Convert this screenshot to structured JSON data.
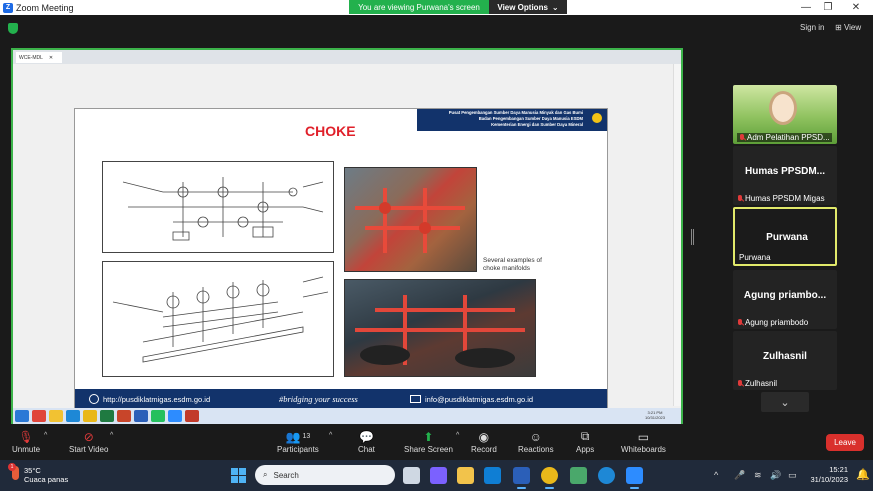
{
  "window": {
    "title": "Zoom Meeting"
  },
  "banner": {
    "viewing": "You are viewing Purwana's screen",
    "view_options": "View Options"
  },
  "top_right": {
    "sign_in": "Sign in",
    "view": "View"
  },
  "shared": {
    "tab_label": "WCE-MDL",
    "slide": {
      "title": "CHOKE",
      "header_lines": [
        "Pusat Pengembangan Sumber Daya Manusia Minyak dan Gas Bumi",
        "Badan Pengembangan Sumber Daya Manusia ESDM",
        "Kementerian Energi dan Sumber Daya Mineral"
      ],
      "caption_1": "Several examples of",
      "caption_2": "choke manifolds",
      "footer_url": "http://pusdiklatmigas.esdm.go.id",
      "footer_tagline": "#bridging your success",
      "footer_email": "info@pusdiklatmigas.esdm.go.id"
    },
    "inner_clock": {
      "time": "3:21 PM",
      "date": "10/31/2023"
    }
  },
  "participants": [
    {
      "label": "Adm Pelatihan PPSD...",
      "muted": true,
      "video": true
    },
    {
      "big": "Humas  PPSDM...",
      "label": "Humas PPSDM Migas",
      "muted": true
    },
    {
      "big": "Purwana",
      "label": "Purwana",
      "muted": false,
      "active": true
    },
    {
      "big": "Agung  priambo...",
      "label": "Agung priambodo",
      "muted": true
    },
    {
      "big": "Zulhasnil",
      "label": "Zulhasnil",
      "muted": true
    }
  ],
  "toolbar": {
    "unmute": "Unmute",
    "start_video": "Start Video",
    "participants": "Participants",
    "participants_count": "13",
    "chat": "Chat",
    "share_screen": "Share Screen",
    "record": "Record",
    "reactions": "Reactions",
    "apps": "Apps",
    "whiteboards": "Whiteboards",
    "leave": "Leave"
  },
  "taskbar": {
    "weather_temp": "35°C",
    "weather_desc": "Cuaca panas",
    "weather_badge": "1",
    "search": "Search",
    "time": "15:21",
    "date": "31/10/2023"
  }
}
